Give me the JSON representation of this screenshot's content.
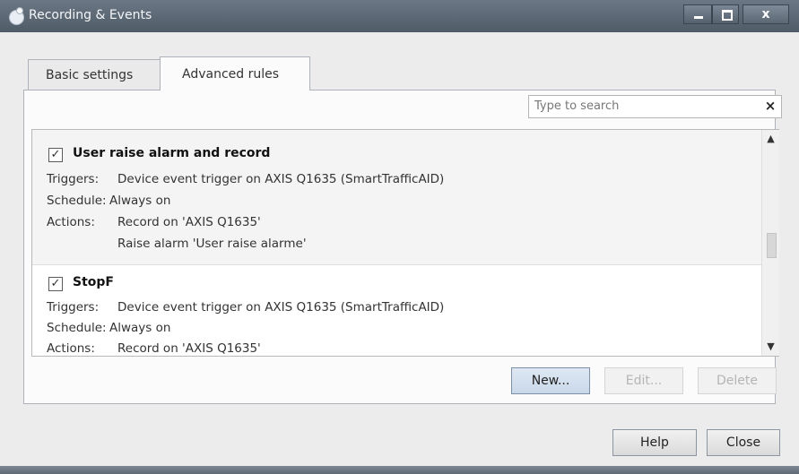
{
  "window": {
    "title": "Recording & Events",
    "controls": {
      "minimize": "–",
      "maximize": "□",
      "close": "x"
    }
  },
  "tabs": [
    {
      "label": "Basic settings",
      "active": false
    },
    {
      "label": "Advanced rules",
      "active": true
    }
  ],
  "search": {
    "placeholder": "Type to search",
    "clear": "×"
  },
  "rules": [
    {
      "name": "User raise alarm and record",
      "checked": true,
      "triggers_label": "Triggers:",
      "triggers": "Device event trigger on AXIS Q1635 (SmartTrafficAID)",
      "schedule_label": "Schedule:",
      "schedule": "Always on",
      "actions_label": "Actions:",
      "actions": [
        "Record on 'AXIS Q1635'",
        "Raise alarm 'User raise alarme'"
      ]
    },
    {
      "name": "StopF",
      "checked": true,
      "triggers_label": "Triggers:",
      "triggers": "Device event trigger on AXIS Q1635 (SmartTrafficAID)",
      "schedule_label": "Schedule:",
      "schedule": "Always on",
      "actions_label": "Actions:",
      "actions": [
        "Record on 'AXIS Q1635'"
      ]
    }
  ],
  "list_buttons": {
    "new": "New...",
    "edit": "Edit...",
    "delete": "Delete"
  },
  "footer_buttons": {
    "help": "Help",
    "close": "Close"
  },
  "icons": {
    "check": "✓",
    "scroll_up": "▲",
    "scroll_down": "▼"
  }
}
